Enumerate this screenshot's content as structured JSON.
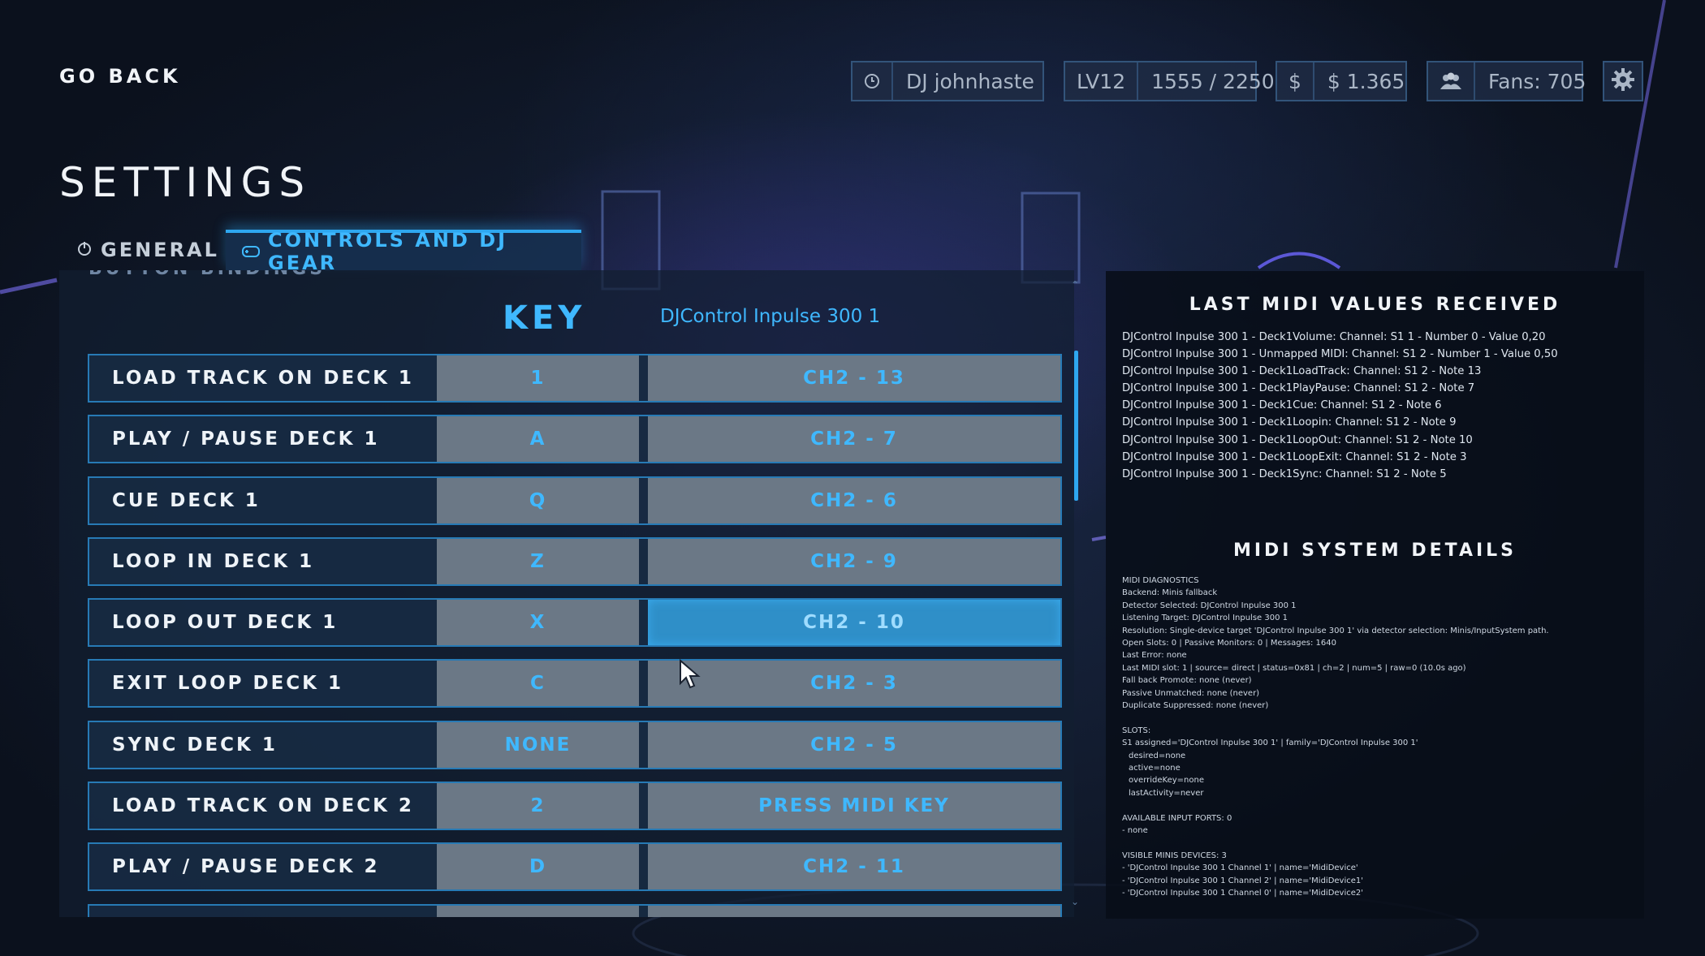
{
  "header": {
    "go_back": "GO BACK",
    "title": "SETTINGS"
  },
  "stats": {
    "dj_name": "DJ johnhaste",
    "level": "LV12",
    "xp": "1555 / 2250",
    "currency_symbol": "$",
    "money": "$ 1.365",
    "fans": "Fans: 705"
  },
  "tabs": [
    {
      "label": "GENERAL",
      "active": false
    },
    {
      "label": "CONTROLS AND DJ GEAR",
      "active": true
    }
  ],
  "bindings": {
    "section_label": "BUTTON BINDINGS",
    "key_header": "KEY",
    "device": "DJControl Inpulse 300 1",
    "rows": [
      {
        "action": "LOAD TRACK ON DECK 1",
        "key": "1",
        "midi": "CH2 - 13"
      },
      {
        "action": "PLAY / PAUSE DECK 1",
        "key": "A",
        "midi": "CH2 - 7"
      },
      {
        "action": "CUE DECK 1",
        "key": "Q",
        "midi": "CH2 - 6"
      },
      {
        "action": "LOOP IN DECK 1",
        "key": "Z",
        "midi": "CH2 - 9"
      },
      {
        "action": "LOOP OUT DECK 1",
        "key": "X",
        "midi": "CH2 - 10"
      },
      {
        "action": "EXIT LOOP DECK 1",
        "key": "C",
        "midi": "CH2 - 3"
      },
      {
        "action": "SYNC DECK 1",
        "key": "NONE",
        "midi": "CH2 - 5"
      },
      {
        "action": "LOAD TRACK ON DECK 2",
        "key": "2",
        "midi": "PRESS MIDI KEY"
      },
      {
        "action": "PLAY / PAUSE DECK 2",
        "key": "D",
        "midi": "CH2 - 11"
      }
    ]
  },
  "midi_panel": {
    "last_values_title": "LAST MIDI VALUES RECEIVED",
    "last_values": [
      "DJControl Inpulse 300 1 - Deck1Volume: Channel: S1 1 - Number 0 - Value 0,20",
      "DJControl Inpulse 300 1 - Unmapped MIDI: Channel: S1 2 - Number 1 - Value 0,50",
      "DJControl Inpulse 300 1 - Deck1LoadTrack: Channel: S1 2 - Note 13",
      "DJControl Inpulse 300 1 - Deck1PlayPause: Channel: S1 2 - Note 7",
      "DJControl Inpulse 300 1 - Deck1Cue: Channel: S1 2 - Note 6",
      "DJControl Inpulse 300 1 - Deck1Loopin: Channel: S1 2 - Note 9",
      "DJControl Inpulse 300 1 - Deck1LoopOut: Channel: S1 2 - Note 10",
      "DJControl Inpulse 300 1 - Deck1LoopExit: Channel: S1 2 - Note 3",
      "DJControl Inpulse 300 1 - Deck1Sync: Channel: S1 2 - Note 5"
    ],
    "system_title": "MIDI SYSTEM DETAILS",
    "system_lines": [
      "MIDI DIAGNOSTICS",
      "Backend: Minis fallback",
      "Detector Selected: DJControl Inpulse 300 1",
      "Listening Target: DJControl Inpulse 300 1",
      "Resolution: Single-device target 'DJControl Inpulse 300 1' via detector selection: Minis/InputSystem path.",
      "Open Slots: 0 | Passive Monitors: 0 | Messages: 1640",
      "Last Error: none",
      "Last MIDI slot: 1 | source= direct | status=0x81 | ch=2 | num=5 | raw=0 (10.0s ago)",
      "Fall back Promote: none (never)",
      "Passive Unmatched: none (never)",
      "Duplicate Suppressed: none (never)",
      "",
      "SLOTS:",
      "S1 assigned='DJControl Inpulse 300 1' | family='DJControl Inpulse 300 1'",
      "  desired=none",
      "  active=none",
      "  overrideKey=none",
      "  lastActivity=never",
      "",
      "AVAILABLE INPUT PORTS: 0",
      "- none",
      "",
      "VISIBLE MINIS DEVICES: 3",
      "- 'DJControl Inpulse 300 1 Channel 1' | name='MidiDevice'",
      "- 'DJControl Inpulse 300 1 Channel 2' | name='MidiDevice1'",
      "- 'DJControl Inpulse 300 1 Channel 0' | name='MidiDevice2'"
    ]
  },
  "colors": {
    "accent": "#3fb8ff",
    "row_border": "#2e96dc",
    "cell_bg": "#6b7886",
    "active_cell": "#2f8fc8"
  },
  "icons": [
    "power-icon",
    "gamepad-icon",
    "clock-icon",
    "dollar-icon",
    "crowd-icon",
    "gear-icon",
    "chevron-down-icon",
    "mouse-cursor-icon"
  ]
}
